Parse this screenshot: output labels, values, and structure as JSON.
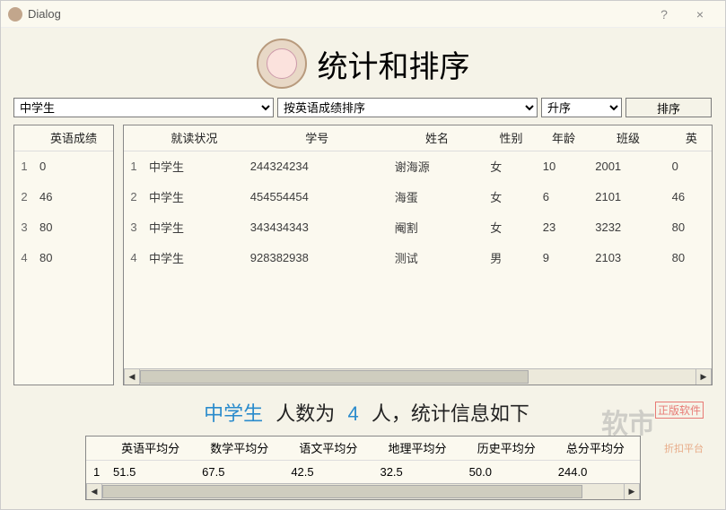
{
  "window": {
    "title": "Dialog"
  },
  "heading": "统计和排序",
  "combo1": {
    "value": "中学生"
  },
  "combo2": {
    "value": "按英语成绩排序"
  },
  "combo3": {
    "value": "升序"
  },
  "sort_btn": "排序",
  "small_table": {
    "header": "英语成绩",
    "rows": [
      {
        "idx": "1",
        "val": "0"
      },
      {
        "idx": "2",
        "val": "46"
      },
      {
        "idx": "3",
        "val": "80"
      },
      {
        "idx": "4",
        "val": "80"
      }
    ]
  },
  "main_table": {
    "headers": [
      "就读状况",
      "学号",
      "姓名",
      "性别",
      "年龄",
      "班级",
      "英"
    ],
    "rows": [
      {
        "idx": "1",
        "c": [
          "中学生",
          "244324234",
          "谢海源",
          "女",
          "10",
          "2001",
          "0"
        ]
      },
      {
        "idx": "2",
        "c": [
          "中学生",
          "454554454",
          "海蛋",
          "女",
          "6",
          "2101",
          "46"
        ]
      },
      {
        "idx": "3",
        "c": [
          "中学生",
          "343434343",
          "阉割",
          "女",
          "23",
          "3232",
          "80"
        ]
      },
      {
        "idx": "4",
        "c": [
          "中学生",
          "928382938",
          "测试",
          "男",
          "9",
          "2103",
          "80"
        ]
      }
    ]
  },
  "stat_text": {
    "group": "中学生",
    "pre": "人数为",
    "count": "4",
    "post": "人，统计信息如下"
  },
  "stats": {
    "headers": [
      "英语平均分",
      "数学平均分",
      "语文平均分",
      "地理平均分",
      "历史平均分",
      "总分平均分"
    ],
    "row_idx": "1",
    "values": [
      "51.5",
      "67.5",
      "42.5",
      "32.5",
      "50.0",
      "244.0"
    ]
  },
  "watermark": {
    "main": "软市",
    "tag": "正版软件",
    "sub": "折扣平台"
  }
}
